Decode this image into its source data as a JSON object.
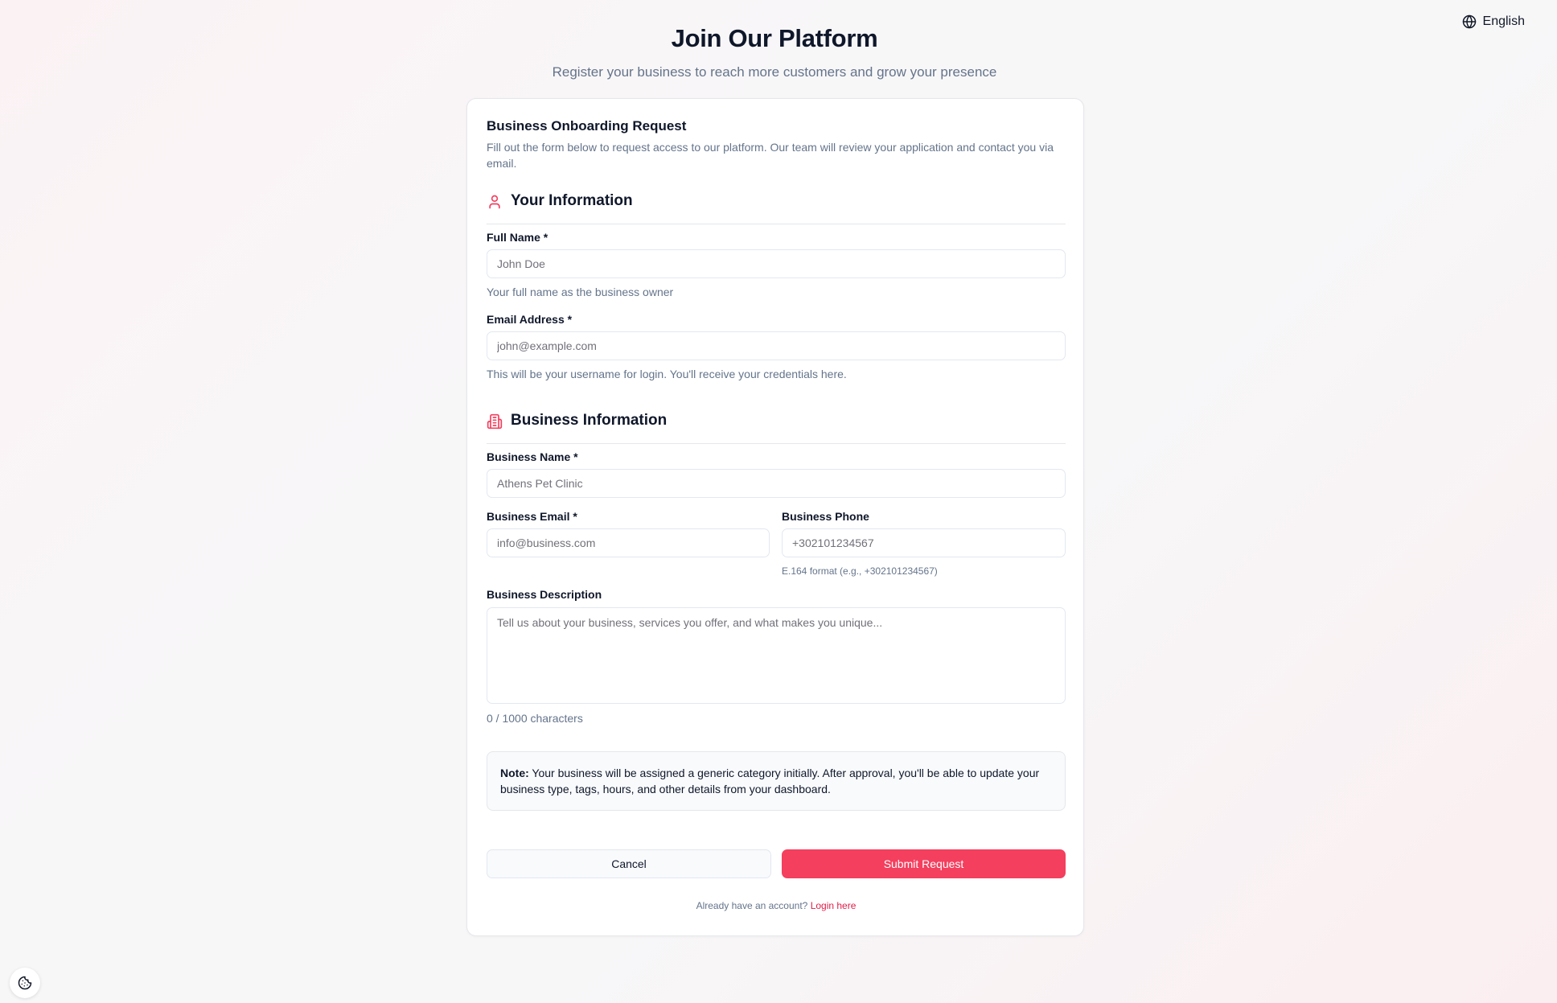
{
  "language": {
    "label": "English",
    "icon": "globe-icon"
  },
  "header": {
    "title": "Join Our Platform",
    "subtitle": "Register your business to reach more customers and grow your presence"
  },
  "card": {
    "title": "Business Onboarding Request",
    "description": "Fill out the form below to request access to our platform. Our team will review your application and contact you via email."
  },
  "sections": {
    "personal": {
      "title": "Your Information",
      "icon": "user-icon"
    },
    "business": {
      "title": "Business Information",
      "icon": "building-icon"
    }
  },
  "fields": {
    "full_name": {
      "label": "Full Name *",
      "placeholder": "John Doe",
      "value": "",
      "hint": "Your full name as the business owner"
    },
    "email": {
      "label": "Email Address *",
      "placeholder": "john@example.com",
      "value": "",
      "hint": "This will be your username for login. You'll receive your credentials here."
    },
    "business_name": {
      "label": "Business Name *",
      "placeholder": "Athens Pet Clinic",
      "value": ""
    },
    "business_email": {
      "label": "Business Email *",
      "placeholder": "info@business.com",
      "value": ""
    },
    "business_phone": {
      "label": "Business Phone",
      "placeholder": "+302101234567",
      "value": "",
      "hint": "E.164 format (e.g., +302101234567)"
    },
    "business_description": {
      "label": "Business Description",
      "placeholder": "Tell us about your business, services you offer, and what makes you unique...",
      "value": "",
      "counter": "0 / 1000 characters"
    }
  },
  "note": {
    "prefix": "Note:",
    "text": "Your business will be assigned a generic category initially. After approval, you'll be able to update your business type, tags, hours, and other details from your dashboard."
  },
  "buttons": {
    "cancel": "Cancel",
    "submit": "Submit Request"
  },
  "footer": {
    "prompt": "Already have an account?",
    "link": "Login here"
  },
  "colors": {
    "accent": "#f43f5e",
    "link": "#e11d48",
    "muted": "#64748b"
  },
  "floating_button": {
    "icon": "cookie-icon"
  }
}
